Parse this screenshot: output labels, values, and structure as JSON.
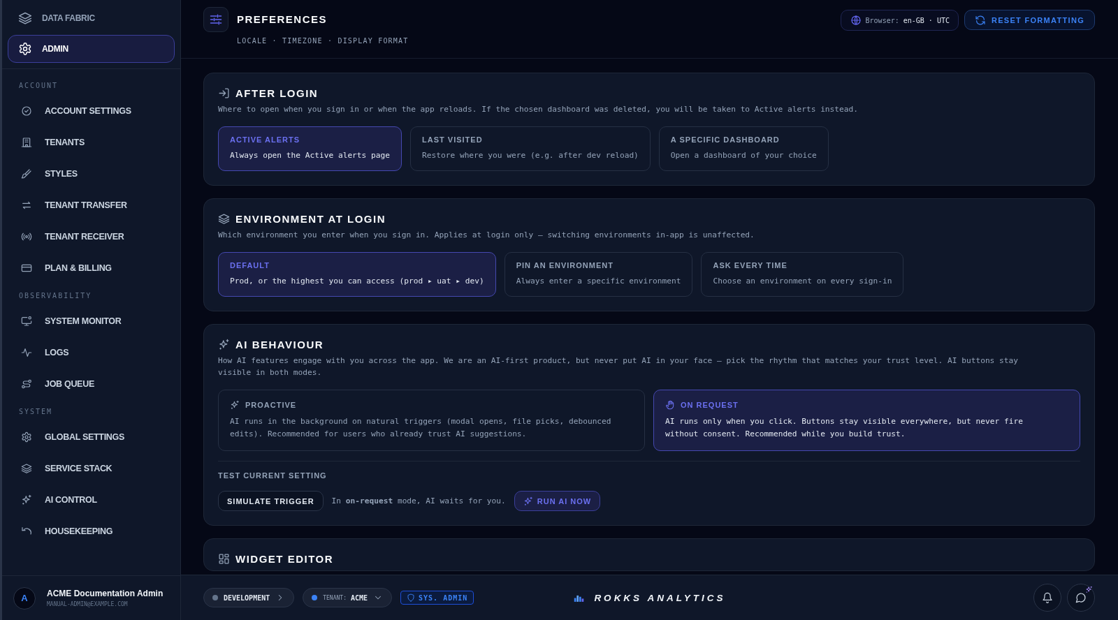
{
  "sidebar": {
    "top_items": [
      {
        "label": "DATA FABRIC",
        "selected": false
      },
      {
        "label": "ADMIN",
        "selected": true
      }
    ],
    "sections": [
      {
        "title": "ACCOUNT",
        "items": [
          {
            "label": "ACCOUNT SETTINGS"
          },
          {
            "label": "TENANTS"
          },
          {
            "label": "STYLES"
          },
          {
            "label": "TENANT TRANSFER"
          },
          {
            "label": "TENANT RECEIVER"
          },
          {
            "label": "PLAN & BILLING"
          }
        ]
      },
      {
        "title": "OBSERVABILITY",
        "items": [
          {
            "label": "SYSTEM MONITOR"
          },
          {
            "label": "LOGS"
          },
          {
            "label": "JOB QUEUE"
          }
        ]
      },
      {
        "title": "SYSTEM",
        "items": [
          {
            "label": "GLOBAL SETTINGS"
          },
          {
            "label": "SERVICE STACK"
          },
          {
            "label": "AI CONTROL"
          },
          {
            "label": "HOUSEKEEPING"
          }
        ]
      }
    ],
    "user": {
      "initial": "A",
      "name": "ACME Documentation Admin",
      "email": "MANUAL-ADMIN@EXAMPLE.COM"
    }
  },
  "header": {
    "title": "PREFERENCES",
    "subtitle": "LOCALE · TIMEZONE · DISPLAY FORMAT",
    "browser_label": "Browser:",
    "browser_value": "en-GB · UTC",
    "reset_button": "RESET FORMATTING"
  },
  "sections": [
    {
      "title": "AFTER LOGIN",
      "description": "Where to open when you sign in or when the app reloads. If the chosen dashboard was deleted, you will be taken to Active alerts instead.",
      "options": [
        {
          "title": "ACTIVE ALERTS",
          "description": "Always open the Active alerts page",
          "selected": true
        },
        {
          "title": "LAST VISITED",
          "description": "Restore where you were (e.g. after dev reload)",
          "selected": false
        },
        {
          "title": "A SPECIFIC DASHBOARD",
          "description": "Open a dashboard of your choice",
          "selected": false
        }
      ]
    },
    {
      "title": "ENVIRONMENT AT LOGIN",
      "description": "Which environment you enter when you sign in. Applies at login only — switching environments in-app is unaffected.",
      "options": [
        {
          "title": "DEFAULT",
          "description": "Prod, or the highest you can access (prod ▸ uat ▸ dev)",
          "selected": true
        },
        {
          "title": "PIN AN ENVIRONMENT",
          "description": "Always enter a specific environment",
          "selected": false
        },
        {
          "title": "ASK EVERY TIME",
          "description": "Choose an environment on every sign-in",
          "selected": false
        }
      ]
    },
    {
      "title": "AI BEHAVIOUR",
      "description": "How AI features engage with you across the app. We are an AI-first product, but never put AI in your face — pick the rhythm that matches your trust level. AI buttons stay visible in both modes.",
      "options": [
        {
          "title": "PROACTIVE",
          "description": "AI runs in the background on natural triggers (modal opens, file picks, debounced edits). Recommended for users who already trust AI suggestions.",
          "selected": false
        },
        {
          "title": "ON REQUEST",
          "description": "AI runs only when you click. Buttons stay visible everywhere, but never fire without consent. Recommended while you build trust.",
          "selected": true
        }
      ],
      "test": {
        "label": "TEST CURRENT SETTING",
        "simulate_button": "SIMULATE TRIGGER",
        "note": "In **on-request** mode, AI waits for you.",
        "run_button": "RUN AI NOW"
      }
    },
    {
      "title": "WIDGET EDITOR"
    }
  ],
  "footer": {
    "environment": "DEVELOPMENT",
    "tenant_label": "TENANT:",
    "tenant_value": "ACME",
    "role_badge": "SYS. ADMIN",
    "brand": "ROKKS ANALYTICS"
  }
}
